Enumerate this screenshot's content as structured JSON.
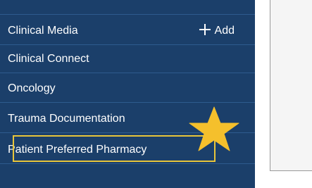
{
  "sidebar": {
    "items": [
      {
        "label": "Clinical Media",
        "action": {
          "icon": "plus-icon",
          "label": "Add"
        }
      },
      {
        "label": "Clinical Connect"
      },
      {
        "label": "Oncology"
      },
      {
        "label": "Trauma Documentation"
      },
      {
        "label": "Patient Preferred Pharmacy",
        "highlighted": true
      }
    ]
  },
  "annotation": {
    "icon": "star-icon",
    "color": "#f5c02c",
    "outline_color": "#e8c53a"
  },
  "colors": {
    "sidebar_background": "#1b3f6a",
    "divider": "#2e5b8e",
    "text": "#ffffff"
  }
}
